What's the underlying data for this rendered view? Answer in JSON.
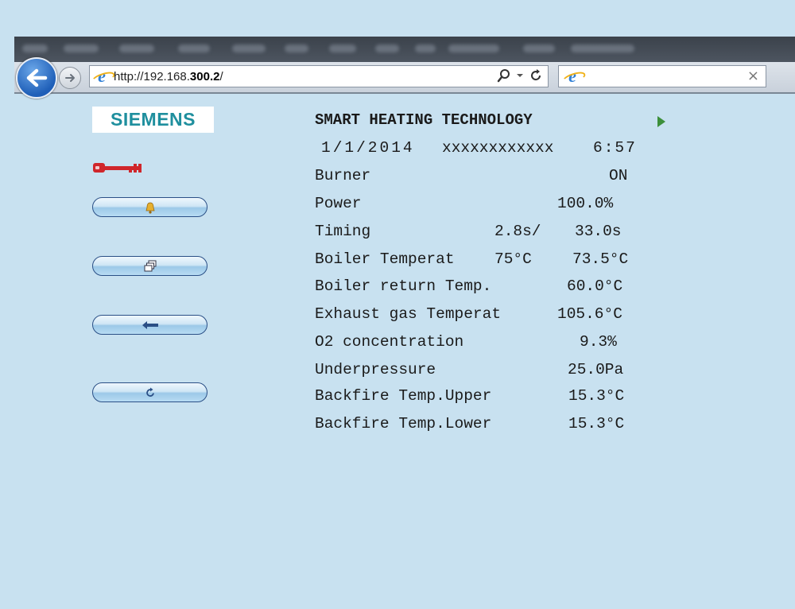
{
  "browser": {
    "url_prefix": "http://192.168.",
    "url_bold": "300.2",
    "url_suffix": "/",
    "tab_close": "×"
  },
  "logo": {
    "text": "SIEMENS",
    "color": "#1f8f9e"
  },
  "sidebar": {
    "key_icon": "key-icon",
    "buttons": [
      {
        "name": "alarm-bell-button",
        "icon": "bell-icon"
      },
      {
        "name": "windows-button",
        "icon": "windows-icon"
      },
      {
        "name": "back-button",
        "icon": "back-arrow-icon"
      },
      {
        "name": "refresh-button",
        "icon": "refresh-icon"
      }
    ]
  },
  "panel": {
    "title": "SMART HEATING TECHNOLOGY",
    "date": "1/1/2014",
    "device": "xxxxxxxxxxxx",
    "time": "6:57",
    "rows": [
      {
        "label": "Burner",
        "value": "ON"
      },
      {
        "label": "Power",
        "value": "100.0%"
      },
      {
        "label": "Timing",
        "value1": "2.8s/",
        "value2": "33.0s"
      },
      {
        "label": "Boiler Temperat",
        "value1": "75°C",
        "value2": "73.5°C"
      },
      {
        "label": "Boiler return Temp.",
        "value": "60.0°C"
      },
      {
        "label": "Exhaust gas Temperat",
        "value": "105.6°C"
      },
      {
        "label": "O2 concentration",
        "value": "9.3%"
      },
      {
        "label": "Underpressure",
        "value": "25.0Pa"
      },
      {
        "label": "Backfire Temp.Upper",
        "value": "15.3°C"
      },
      {
        "label": "Backfire Temp.Lower",
        "value": "15.3°C"
      }
    ]
  },
  "colors": {
    "background": "#c8e1f0",
    "key": "#d0262b",
    "play": "#3c8f3a",
    "button_border": "#2a4f86"
  }
}
